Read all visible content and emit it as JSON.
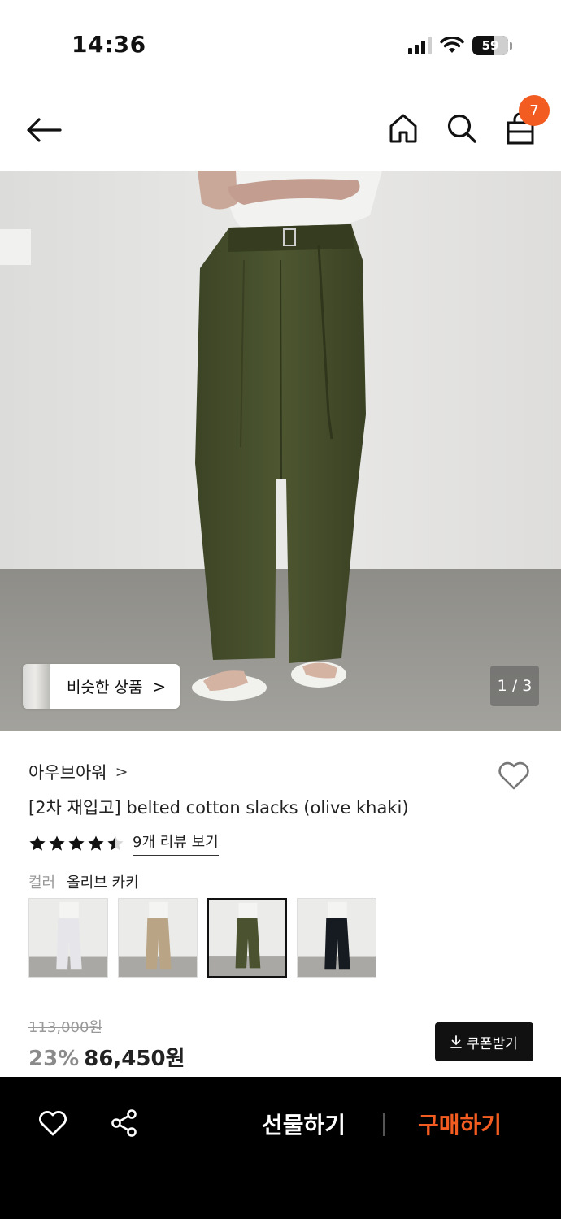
{
  "status_bar": {
    "time": "14:36",
    "battery": "59",
    "icons": [
      "signal-icon",
      "wifi-icon",
      "battery-icon"
    ]
  },
  "header": {
    "icons": [
      "back-arrow-icon",
      "home-icon",
      "search-icon",
      "shopping-bag-icon"
    ],
    "cart_count": "7"
  },
  "gallery": {
    "similar_label": "비슷한 상품",
    "similar_chevron": ">",
    "page_indicator": "1 / 3"
  },
  "product": {
    "brand": "아우브아워",
    "brand_chevron": ">",
    "title": "[2차 재입고] belted cotton slacks (olive khaki)",
    "rating": 4.5,
    "review_link": "9개 리뷰 보기",
    "color_label": "컬러",
    "color_value": "올리브 카키",
    "swatches": [
      {
        "color": "#e6e6ea"
      },
      {
        "color": "#b9a486"
      },
      {
        "color": "#4a5230"
      },
      {
        "color": "#161b22"
      }
    ],
    "selected_swatch": 3,
    "original_price": "113,000원",
    "discount": "23%",
    "price": "86,450원",
    "coupon_label": "쿠폰받기",
    "coupon_icon": "download-icon"
  },
  "bottom_bar": {
    "icons": [
      "heart-icon",
      "share-icon"
    ],
    "gift_label": "선물하기",
    "buy_label": "구매하기",
    "accent_color": "#f25c21"
  }
}
